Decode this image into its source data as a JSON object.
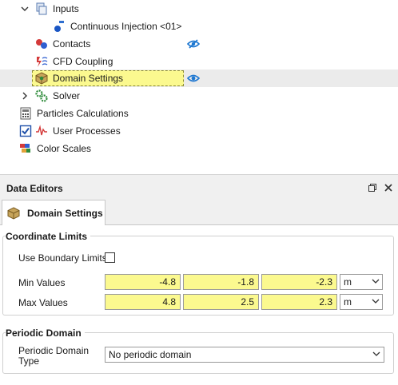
{
  "tree": {
    "inputs": "Inputs",
    "continuous_injection": "Continuous Injection <01>",
    "contacts": "Contacts",
    "cfd_coupling": "CFD Coupling",
    "domain_settings": "Domain Settings",
    "solver": "Solver",
    "particles_calculations": "Particles Calculations",
    "user_processes": "User Processes",
    "color_scales": "Color Scales",
    "user_processes_checked": true
  },
  "data_editors": {
    "title": "Data Editors",
    "tab_label": "Domain Settings"
  },
  "coordinate_limits": {
    "title": "Coordinate Limits",
    "use_boundary_label": "Use Boundary Limits",
    "use_boundary_checked": false,
    "min_label": "Min Values",
    "max_label": "Max Values",
    "min_values": [
      "-4.8",
      "-1.8",
      "-2.3"
    ],
    "max_values": [
      "4.8",
      "2.5",
      "2.3"
    ],
    "min_unit": "m",
    "max_unit": "m"
  },
  "periodic_domain": {
    "title": "Periodic Domain",
    "type_label_line1": "Periodic Domain",
    "type_label_line2": "Type",
    "type_value": "No periodic domain"
  },
  "colors": {
    "highlight": "#fbf98f",
    "selected_row": "#ebebeb",
    "eye_blue": "#1f78d1"
  }
}
